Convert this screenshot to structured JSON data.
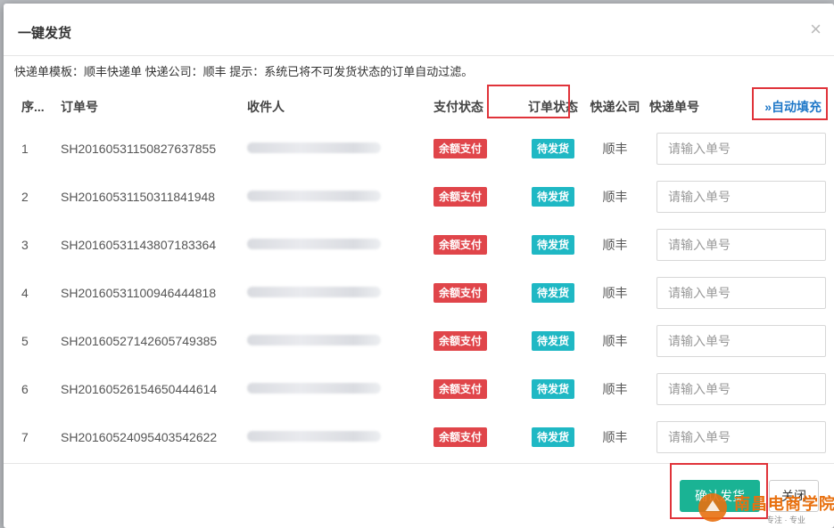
{
  "modal": {
    "title": "一键发货",
    "close_glyph": "×",
    "hint": "快递单模板：顺丰快递单 快递公司：顺丰 提示：系统已将不可发货状态的订单自动过滤。"
  },
  "table": {
    "headers": {
      "index": "序...",
      "order_no": "订单号",
      "receiver": "收件人",
      "pay_status": "支付状态",
      "order_status": "订单状态",
      "express_company": "快递公司",
      "tracking_no": "快递单号",
      "auto_fill": "自动填充"
    },
    "auto_fill_icon": "double-chevron-down-icon",
    "rows": [
      {
        "index": "1",
        "order_no": "SH20160531150827637855",
        "pay": "余额支付",
        "status": "待发货",
        "company": "顺丰",
        "placeholder": "请输入单号"
      },
      {
        "index": "2",
        "order_no": "SH20160531150311841948",
        "pay": "余额支付",
        "status": "待发货",
        "company": "顺丰",
        "placeholder": "请输入单号"
      },
      {
        "index": "3",
        "order_no": "SH20160531143807183364",
        "pay": "余额支付",
        "status": "待发货",
        "company": "顺丰",
        "placeholder": "请输入单号"
      },
      {
        "index": "4",
        "order_no": "SH20160531100946444818",
        "pay": "余额支付",
        "status": "待发货",
        "company": "顺丰",
        "placeholder": "请输入单号"
      },
      {
        "index": "5",
        "order_no": "SH20160527142605749385",
        "pay": "余额支付",
        "status": "待发货",
        "company": "顺丰",
        "placeholder": "请输入单号"
      },
      {
        "index": "6",
        "order_no": "SH20160526154650444614",
        "pay": "余额支付",
        "status": "待发货",
        "company": "顺丰",
        "placeholder": "请输入单号"
      },
      {
        "index": "7",
        "order_no": "SH20160524095403542622",
        "pay": "余额支付",
        "status": "待发货",
        "company": "顺丰",
        "placeholder": "请输入单号"
      }
    ]
  },
  "footer": {
    "confirm_label": "确认发货",
    "close_label": "关闭"
  },
  "watermark": {
    "name": "南昌电商学院",
    "sub": "专注 · 专业"
  },
  "colors": {
    "accent_green": "#1ab394",
    "pay_badge": "#e0454a",
    "status_badge": "#1fb8c4",
    "highlight_box": "#e0333a",
    "link_blue": "#1f78c8"
  }
}
